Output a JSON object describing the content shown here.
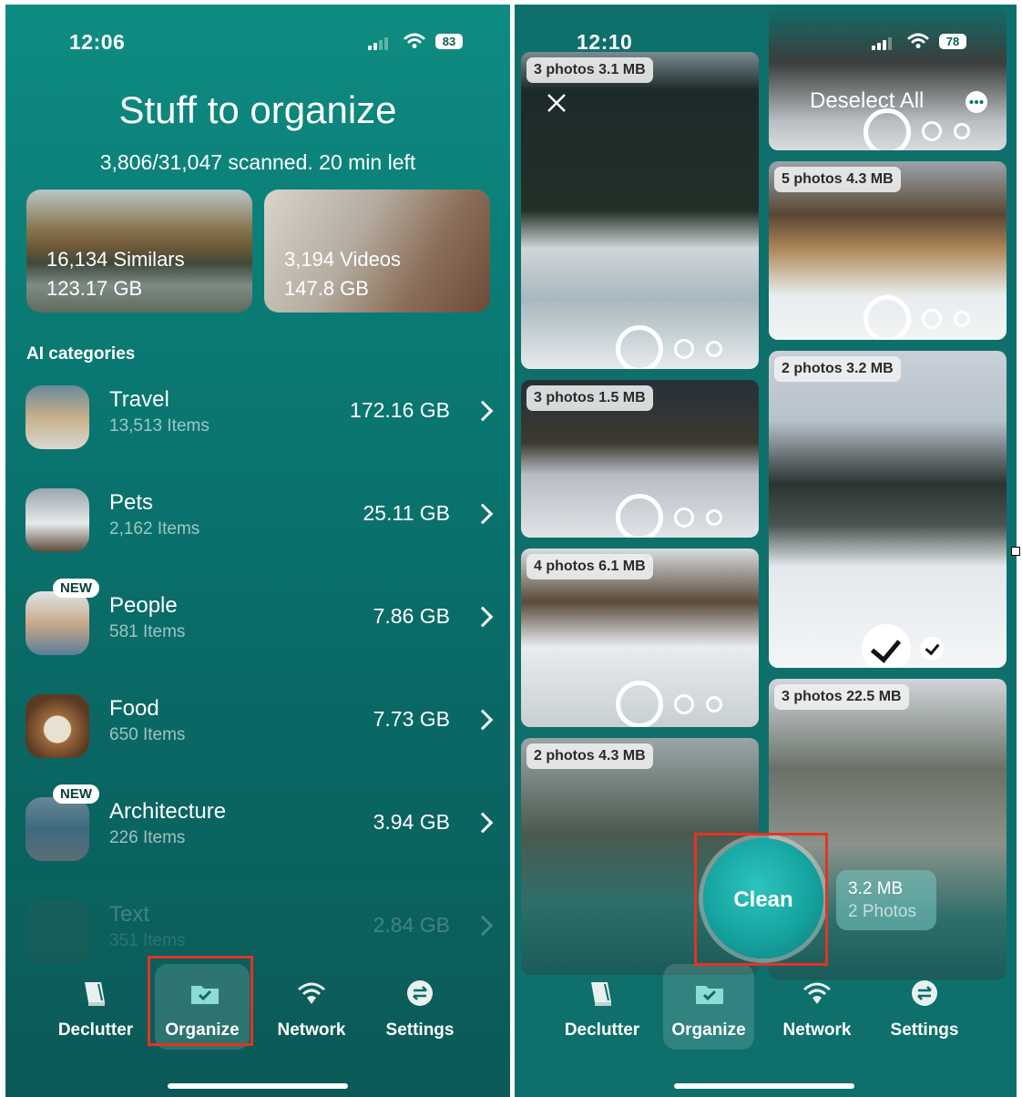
{
  "left": {
    "status": {
      "time": "12:06",
      "battery": "83"
    },
    "title": "Stuff to organize",
    "scan_status": "3,806/31,047 scanned. 20 min left",
    "cards": [
      {
        "title": "16,134 Similars",
        "size": "123.17 GB"
      },
      {
        "title": "3,194 Videos",
        "size": "147.8 GB"
      }
    ],
    "section_title": "AI categories",
    "categories": [
      {
        "name": "Travel",
        "count": "13,513 Items",
        "size": "172.16 GB",
        "badge": ""
      },
      {
        "name": "Pets",
        "count": "2,162 Items",
        "size": "25.11 GB",
        "badge": ""
      },
      {
        "name": "People",
        "count": "581 Items",
        "size": "7.86 GB",
        "badge": "NEW"
      },
      {
        "name": "Food",
        "count": "650 Items",
        "size": "7.73 GB",
        "badge": ""
      },
      {
        "name": "Architecture",
        "count": "226 Items",
        "size": "3.94 GB",
        "badge": "NEW"
      },
      {
        "name": "Text",
        "count": "351 Items",
        "size": "2.84 GB",
        "badge": ""
      }
    ],
    "tabs": [
      "Declutter",
      "Organize",
      "Network",
      "Settings"
    ],
    "active_tab": "Organize"
  },
  "right": {
    "status": {
      "time": "12:10",
      "battery": "78"
    },
    "deselect_all": "Deselect All",
    "groups": [
      {
        "label": "3 photos 3.1 MB"
      },
      {
        "label": "3 photos 1.5 MB"
      },
      {
        "label": "4 photos 6.1 MB"
      },
      {
        "label": "2 photos 4.3 MB"
      },
      {
        "label": "5 photos 4.3 MB"
      },
      {
        "label": "2 photos 3.2 MB"
      },
      {
        "label": "3 photos 22.5 MB"
      }
    ],
    "clean_button": "Clean",
    "selection": {
      "size": "3.2 MB",
      "count": "2 Photos"
    },
    "tabs": [
      "Declutter",
      "Organize",
      "Network",
      "Settings"
    ],
    "active_tab": "Organize"
  },
  "colors": {
    "accent": "#0e8c82",
    "highlight_box": "#e53323",
    "clean_button": "#15a3a0"
  }
}
